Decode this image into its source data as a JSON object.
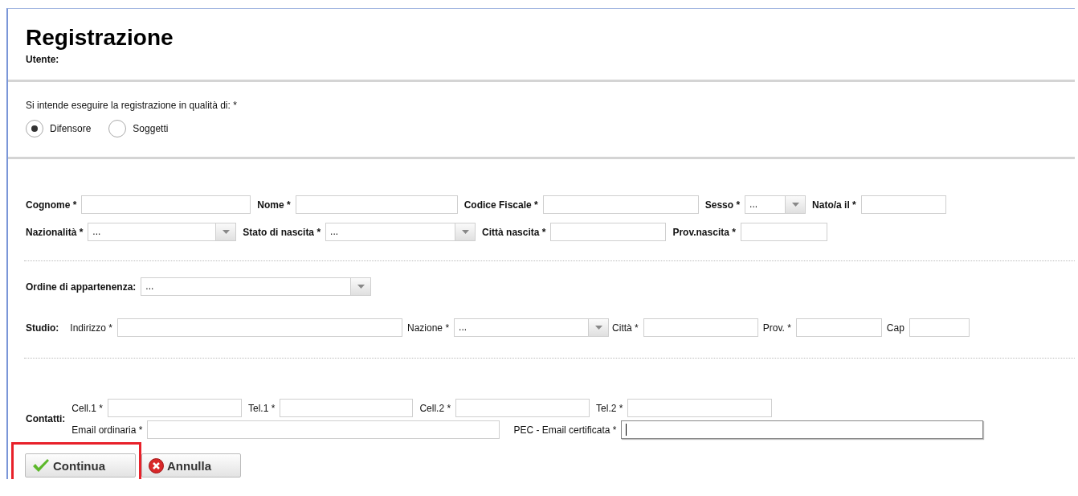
{
  "title": "Registrazione",
  "user_label": "Utente:",
  "role": {
    "question": "Si intende eseguire la registrazione in qualità di: *",
    "options": [
      {
        "label": "Difensore",
        "selected": true
      },
      {
        "label": "Soggetti",
        "selected": false
      }
    ]
  },
  "personal": {
    "rows": [
      [
        {
          "label": "Cognome *",
          "kind": "text",
          "focused": false
        },
        {
          "label": "Nome *",
          "kind": "text",
          "focused": false
        },
        {
          "label": "Codice Fiscale *",
          "kind": "text",
          "focused": false
        },
        {
          "label": "Sesso *",
          "kind": "select",
          "value": "...",
          "focused": false
        },
        {
          "label": "Nato/a il *",
          "kind": "text",
          "focused": false
        }
      ],
      [
        {
          "label": "Nazionalità *",
          "kind": "select",
          "value": "...",
          "focused": false
        },
        {
          "label": "Stato di nascita *",
          "kind": "select",
          "value": "...",
          "focused": false
        },
        {
          "label": "Città nascita *",
          "kind": "text",
          "focused": false
        },
        {
          "label": "Prov.nascita *",
          "kind": "text",
          "focused": false
        }
      ]
    ]
  },
  "order": {
    "label": "Ordine di appartenenza:",
    "kind": "select",
    "value": "...",
    "focused": false
  },
  "studio": {
    "label": "Studio:",
    "fields": [
      {
        "label": "Indirizzo *",
        "kind": "text",
        "focused": false
      },
      {
        "label": "Nazione *",
        "kind": "select",
        "value": "...",
        "focused": false
      },
      {
        "label": "Città *",
        "kind": "text",
        "focused": false
      },
      {
        "label": "Prov. *",
        "kind": "text",
        "focused": false
      },
      {
        "label": "Cap",
        "kind": "text",
        "focused": false
      }
    ]
  },
  "contacts": {
    "label": "Contatti:",
    "phones": [
      {
        "label": "Cell.1 *",
        "kind": "text",
        "focused": false
      },
      {
        "label": "Tel.1 *",
        "kind": "text",
        "focused": false
      },
      {
        "label": "Cell.2 *",
        "kind": "text",
        "focused": false
      },
      {
        "label": "Tel.2 *",
        "kind": "text",
        "focused": false
      }
    ],
    "emails": [
      {
        "label": "Email ordinaria *",
        "kind": "text",
        "focused": false
      },
      {
        "label": "PEC - Email certificata *",
        "kind": "text",
        "focused": true
      }
    ]
  },
  "buttons": [
    {
      "label": "Continua",
      "kind": "confirm",
      "highlighted": true
    },
    {
      "label": "Annulla",
      "kind": "cancel",
      "highlighted": false
    }
  ]
}
